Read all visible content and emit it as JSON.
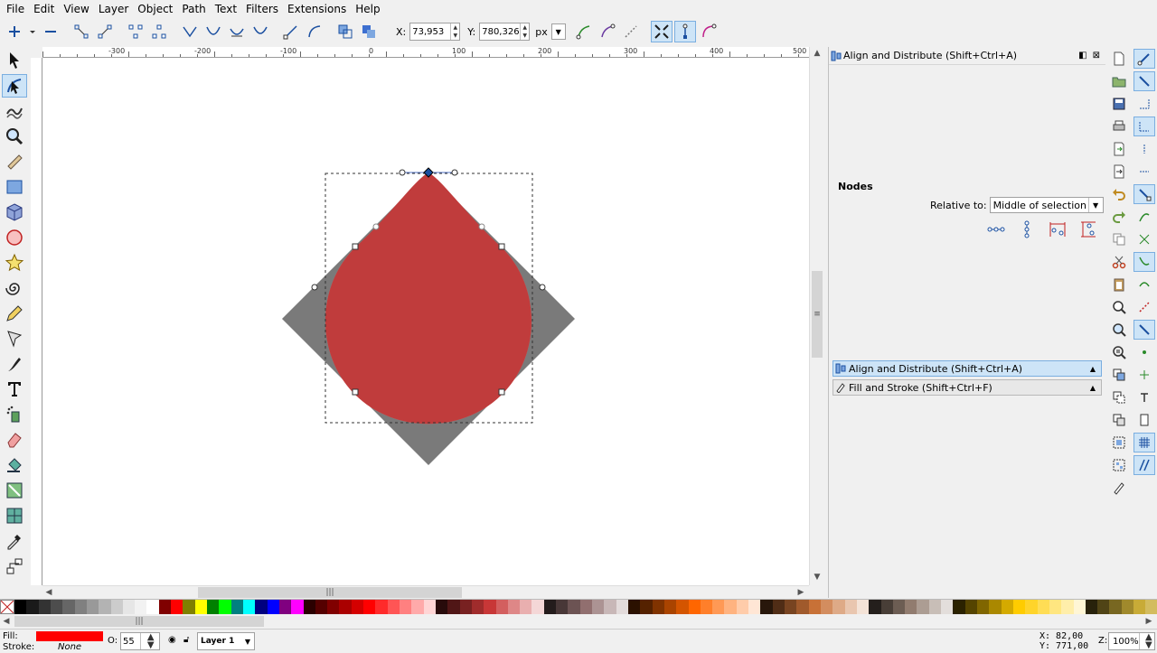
{
  "menu": [
    "File",
    "Edit",
    "View",
    "Layer",
    "Object",
    "Path",
    "Text",
    "Filters",
    "Extensions",
    "Help"
  ],
  "toolbar": {
    "x_label": "X:",
    "x_value": "73,953",
    "y_label": "Y:",
    "y_value": "780,326",
    "unit": "px"
  },
  "hruler": {
    "labels": [
      "-300",
      "-200",
      "-100",
      "0",
      "100",
      "200",
      "300",
      "400",
      "500"
    ]
  },
  "dock": {
    "title": "Align and Distribute (Shift+Ctrl+A)",
    "nodes_heading": "Nodes",
    "relative_label": "Relative to:",
    "relative_value": "Middle of selection",
    "tabs": [
      {
        "label": "Align and Distribute (Shift+Ctrl+A)"
      },
      {
        "label": "Fill and Stroke (Shift+Ctrl+F)"
      }
    ]
  },
  "palette": {
    "colors": [
      "#000000",
      "#1a1a1a",
      "#333333",
      "#4d4d4d",
      "#666666",
      "#808080",
      "#999999",
      "#b3b3b3",
      "#cccccc",
      "#e6e6e6",
      "#f2f2f2",
      "#ffffff",
      "#800000",
      "#ff0000",
      "#808000",
      "#ffff00",
      "#008000",
      "#00ff00",
      "#008080",
      "#00ffff",
      "#000080",
      "#0000ff",
      "#800080",
      "#ff00ff",
      "#2b0000",
      "#550000",
      "#800000",
      "#aa0000",
      "#d40000",
      "#ff0000",
      "#ff2a2a",
      "#ff5555",
      "#ff8080",
      "#ffaaaa",
      "#ffd5d5",
      "#280b0b",
      "#501616",
      "#782121",
      "#a02c2c",
      "#c83737",
      "#d35f5f",
      "#de8787",
      "#e9afaf",
      "#f4d7d7",
      "#241c1c",
      "#483737",
      "#6c5353",
      "#916f6f",
      "#ac9393",
      "#c8b7b7",
      "#e3dbdb",
      "#2b1100",
      "#552200",
      "#803300",
      "#aa4400",
      "#d45500",
      "#ff6600",
      "#ff7f2a",
      "#ff9955",
      "#ffb380",
      "#ffccaa",
      "#ffe6d5",
      "#28170b",
      "#502d16",
      "#784421",
      "#a05a2c",
      "#c87137",
      "#d38d5f",
      "#deaa87",
      "#e9c6af",
      "#f4e3d7",
      "#241f1c",
      "#483e37",
      "#6c5d53",
      "#917c6f",
      "#ac9d93",
      "#c8beb7",
      "#e3dedb",
      "#2b2200",
      "#554400",
      "#806600",
      "#aa8800",
      "#d4aa00",
      "#ffcc00",
      "#ffd42a",
      "#ffdd55",
      "#ffe680",
      "#ffeeaa",
      "#fff6d5",
      "#28220b",
      "#504416",
      "#786721",
      "#a0892c",
      "#c8ab37",
      "#d3bc5f"
    ]
  },
  "status": {
    "fill_label": "Fill:",
    "stroke_label": "Stroke:",
    "fill_color": "#ff0000",
    "stroke_value": "None",
    "opacity_label": "O:",
    "opacity_value": "55",
    "layer": "Layer 1",
    "x_coord": "X:   82,00",
    "y_coord": "Y:  771,00",
    "zoom_label": "Z:",
    "zoom_value": "100%"
  }
}
